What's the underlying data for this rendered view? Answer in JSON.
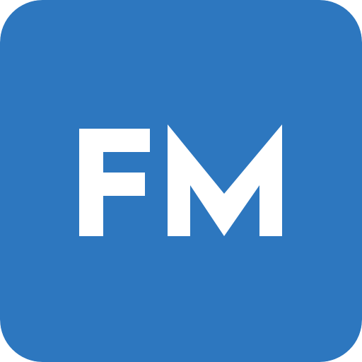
{
  "app_icon": {
    "logo_text": "FM",
    "colors": {
      "background": "#2D77BF",
      "glyph": "#FFFFFF"
    }
  }
}
